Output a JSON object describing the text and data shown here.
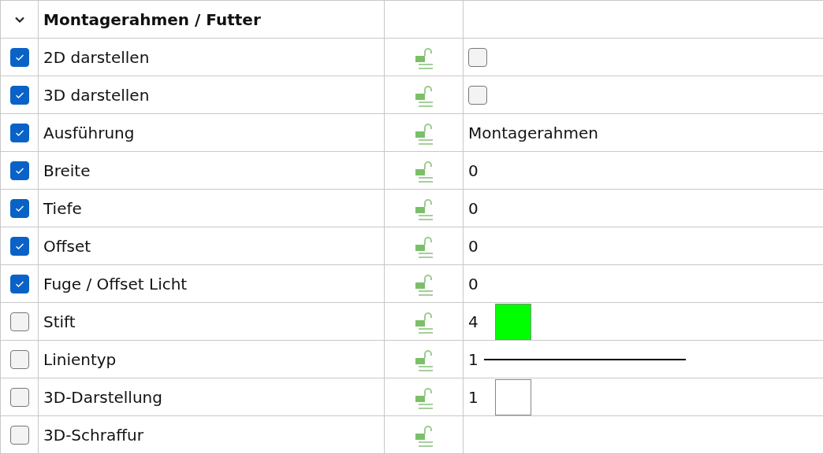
{
  "group": {
    "title": "Montagerahmen / Futter",
    "expanded": true
  },
  "rows": [
    {
      "label": "2D darstellen",
      "checked": true,
      "value": {
        "kind": "checkbox",
        "checked": false
      }
    },
    {
      "label": "3D darstellen",
      "checked": true,
      "value": {
        "kind": "checkbox",
        "checked": false
      }
    },
    {
      "label": "Ausführung",
      "checked": true,
      "value": {
        "kind": "text",
        "text": "Montagerahmen"
      }
    },
    {
      "label": "Breite",
      "checked": true,
      "value": {
        "kind": "text",
        "text": "0"
      }
    },
    {
      "label": "Tiefe",
      "checked": true,
      "value": {
        "kind": "text",
        "text": "0"
      }
    },
    {
      "label": "Offset",
      "checked": true,
      "value": {
        "kind": "text",
        "text": "0"
      }
    },
    {
      "label": "Fuge / Offset Licht",
      "checked": true,
      "value": {
        "kind": "text",
        "text": "0"
      }
    },
    {
      "label": "Stift",
      "checked": false,
      "value": {
        "kind": "swatch",
        "text": "4",
        "color": "#00ff00"
      }
    },
    {
      "label": "Linientyp",
      "checked": false,
      "value": {
        "kind": "line",
        "text": "1"
      }
    },
    {
      "label": "3D-Darstellung",
      "checked": false,
      "value": {
        "kind": "swatch",
        "text": "1",
        "color": "#ffffff"
      }
    },
    {
      "label": "3D-Schraffur",
      "checked": false,
      "value": {
        "kind": "empty"
      }
    }
  ]
}
